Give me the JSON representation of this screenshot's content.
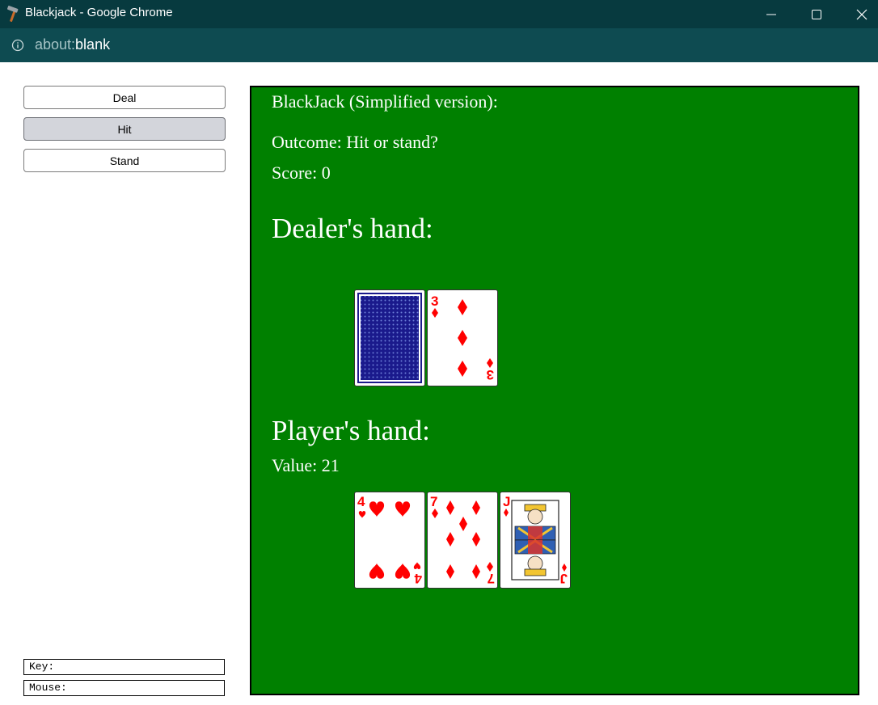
{
  "window": {
    "title": "Blackjack - Google Chrome",
    "url_scheme": "about:",
    "url_rest": "blank"
  },
  "controls": {
    "deal": "Deal",
    "hit": "Hit",
    "stand": "Stand"
  },
  "status": {
    "key": "Key:",
    "mouse": "Mouse:"
  },
  "game": {
    "title": "BlackJack (Simplified version):",
    "outcome": "Outcome: Hit or stand?",
    "score": "Score: 0",
    "dealer_heading": "Dealer's hand:",
    "player_heading": "Player's hand:",
    "player_value": "Value: 21",
    "dealer_cards": [
      {
        "face_down": true
      },
      {
        "rank": "3",
        "suit": "diamonds"
      }
    ],
    "player_cards": [
      {
        "rank": "4",
        "suit": "hearts"
      },
      {
        "rank": "7",
        "suit": "diamonds"
      },
      {
        "rank": "J",
        "suit": "diamonds"
      }
    ]
  },
  "colors": {
    "table_green": "#008000",
    "card_red": "#ff0000",
    "card_back_blue": "#1a1a8c",
    "titlebar": "#073a3f",
    "addressbar": "#0e4b51"
  }
}
